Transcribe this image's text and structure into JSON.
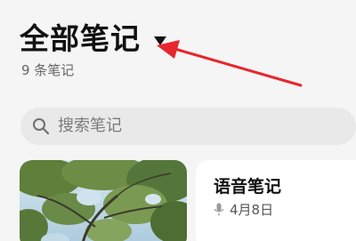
{
  "header": {
    "title": "全部笔记",
    "note_count": "9 条笔记",
    "dropdown_icon": "triangle-down-icon"
  },
  "search": {
    "placeholder": "搜索笔记",
    "icon": "search-icon"
  },
  "notes": [
    {
      "type": "image",
      "thumbnail": "tree-photo"
    },
    {
      "type": "voice",
      "title": "语音笔记",
      "icon": "mic-icon",
      "date": "4月8日"
    }
  ],
  "colors": {
    "background": "#f5f5f5",
    "annotation_arrow": "#e8262d",
    "search_bg": "#e9e9e9",
    "card_bg": "#ffffff"
  }
}
